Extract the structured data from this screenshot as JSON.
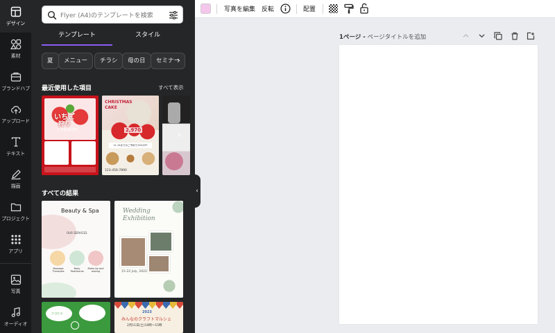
{
  "rail": {
    "items": [
      {
        "label": "デザイン",
        "icon": "layout-icon"
      },
      {
        "label": "素材",
        "icon": "shapes-icon"
      },
      {
        "label": "ブランドハブ",
        "icon": "brand-icon"
      },
      {
        "label": "アップロード",
        "icon": "cloud-upload-icon"
      },
      {
        "label": "テキスト",
        "icon": "text-icon"
      },
      {
        "label": "描画",
        "icon": "draw-icon"
      },
      {
        "label": "プロジェクト",
        "icon": "folder-icon"
      },
      {
        "label": "アプリ",
        "icon": "apps-icon"
      },
      {
        "label": "写真",
        "icon": "photo-icon"
      },
      {
        "label": "オーディオ",
        "icon": "music-icon"
      }
    ]
  },
  "panel": {
    "search_placeholder": "Flyer (A4)のテンプレートを検索",
    "tabs": [
      "テンプレート",
      "スタイル"
    ],
    "chips": [
      "夏",
      "メニュー",
      "チラシ",
      "母の日",
      "セミナー"
    ],
    "recent_title": "最近使用した項目",
    "see_all": "すべて表示",
    "all_results_title": "すべての結果",
    "recent": [
      {
        "title1": "いちご",
        "title2": "狩り",
        "sub": "ご予約受付中"
      },
      {
        "title1": "CHRISTMAS",
        "title2": "CAKE",
        "price": "2,970",
        "sub": "11.15までのご予約で10%OFF",
        "phone": "123-456-7890"
      }
    ],
    "results": [
      {
        "title": "Beauty & Spa",
        "sub": "OUR SERVICES",
        "items": [
          "Massage Therapies",
          "Body Treatments",
          "Make-Up and waxing"
        ]
      },
      {
        "title1": "Wedding",
        "title2": "Exhibition",
        "date": "15-22 July, 2022"
      },
      {
        "text": "ニコニコ"
      },
      {
        "year": "2023",
        "title": "みんなのクラフトマルシェ",
        "date": "2月11日(土)10時〜15時"
      }
    ]
  },
  "toolbar": {
    "color": "#f5c6ec",
    "edit_photo": "写真を編集",
    "flip": "反転",
    "arrange": "配置"
  },
  "page": {
    "label_bold": "1ページ -",
    "label_rest": "ページタイトルを追加"
  }
}
